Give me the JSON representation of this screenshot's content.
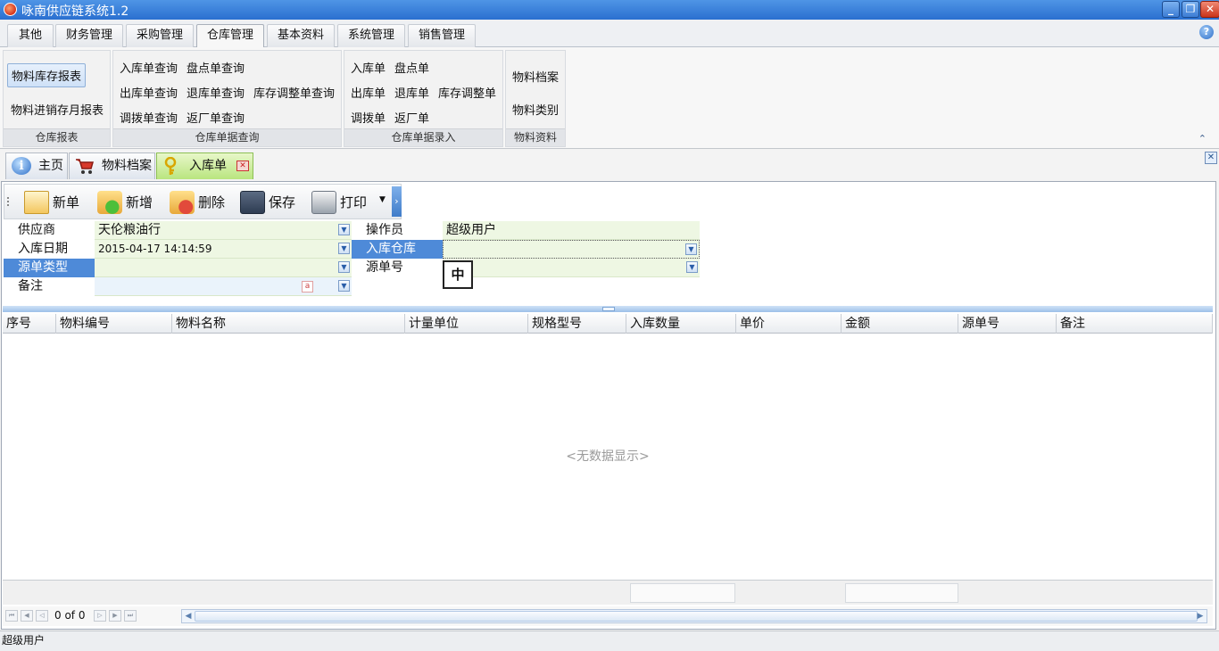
{
  "window": {
    "title": "咏南供应链系统1.2",
    "controls": {
      "minimize": "_",
      "restore": "❐",
      "close": "✕"
    }
  },
  "ribbon_tabs": [
    "其他",
    "财务管理",
    "采购管理",
    "仓库管理",
    "基本资料",
    "系统管理",
    "销售管理"
  ],
  "ribbon_groups": {
    "warehouse_reports": {
      "caption": "仓库报表",
      "items": [
        "物料库存报表",
        "物料进销存月报表"
      ]
    },
    "doc_query": {
      "caption": "仓库单据查询",
      "items": [
        "入库单查询",
        "盘点单查询",
        "出库单查询",
        "退库单查询",
        "库存调整单查询",
        "调拨单查询",
        "返厂单查询"
      ]
    },
    "doc_entry": {
      "caption": "仓库单据录入",
      "items": [
        "入库单",
        "盘点单",
        "出库单",
        "退库单",
        "库存调整单",
        "调拨单",
        "返厂单"
      ]
    },
    "material": {
      "caption": "物料资料",
      "items": [
        "物料档案",
        "物料类别"
      ]
    }
  },
  "doc_tabs": [
    "主页",
    "物料档案",
    "入库单"
  ],
  "toolbar": {
    "new_label": "新单",
    "add_label": "新增",
    "delete_label": "删除",
    "save_label": "保存",
    "print_label": "打印"
  },
  "form": {
    "supplier_label": "供应商",
    "supplier_value": "天伦粮油行",
    "operator_label": "操作员",
    "operator_value": "超级用户",
    "date_label": "入库日期",
    "date_value": "2015-04-17 14:14:59",
    "warehouse_label": "入库仓库",
    "warehouse_value": "",
    "source_type_label": "源单类型",
    "source_type_value": "",
    "source_no_label": "源单号",
    "source_no_value": "",
    "remark_label": "备注",
    "remark_value": "",
    "ime_indicator": "中"
  },
  "grid": {
    "columns": [
      "序号",
      "物料编号",
      "物料名称",
      "计量单位",
      "规格型号",
      "入库数量",
      "单价",
      "金额",
      "源单号",
      "备注"
    ],
    "empty_text": "<无数据显示>"
  },
  "navigator": {
    "page_text": "0 of 0"
  },
  "status": {
    "user": "超级用户"
  }
}
